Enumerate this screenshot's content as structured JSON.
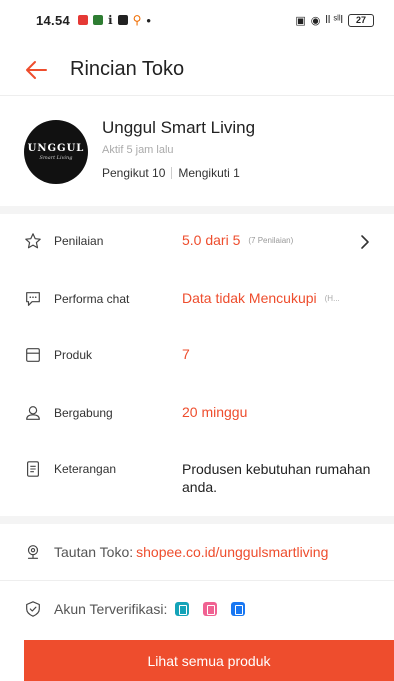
{
  "status_bar": {
    "time": "14.54",
    "battery": "27",
    "network_label": "ll ˢˡˡl"
  },
  "header": {
    "title": "Rincian Toko"
  },
  "shop": {
    "avatar_text": "UNGGUL",
    "avatar_subtext": "Smart Living",
    "name": "Unggul Smart Living",
    "status": "Aktif 5 jam lalu",
    "followers": "Pengikut 10",
    "following": "Mengikuti 1"
  },
  "details": {
    "rating_label": "Penilaian",
    "rating_value": "5.0 dari 5",
    "rating_count": "(7 Penilaian)",
    "chat_label": "Performa chat",
    "chat_value": "Data tidak Mencukupi",
    "chat_sub": "(H...",
    "products_label": "Produk",
    "products_value": "7",
    "joined_label": "Bergabung",
    "joined_value": "20 minggu",
    "description_label": "Keterangan",
    "description_value": "Produsen kebutuhan rumahan anda."
  },
  "link": {
    "label": "Tautan Toko:",
    "url": "shopee.co.id/unggulsmartliving"
  },
  "verified": {
    "label": "Akun Terverifikasi:"
  },
  "cta": {
    "label": "Lihat semua produk"
  },
  "colors": {
    "accent": "#ee4d2d",
    "verify_teal": "#14a3b8",
    "verify_pink": "#f06292",
    "verify_blue": "#1877f2"
  }
}
